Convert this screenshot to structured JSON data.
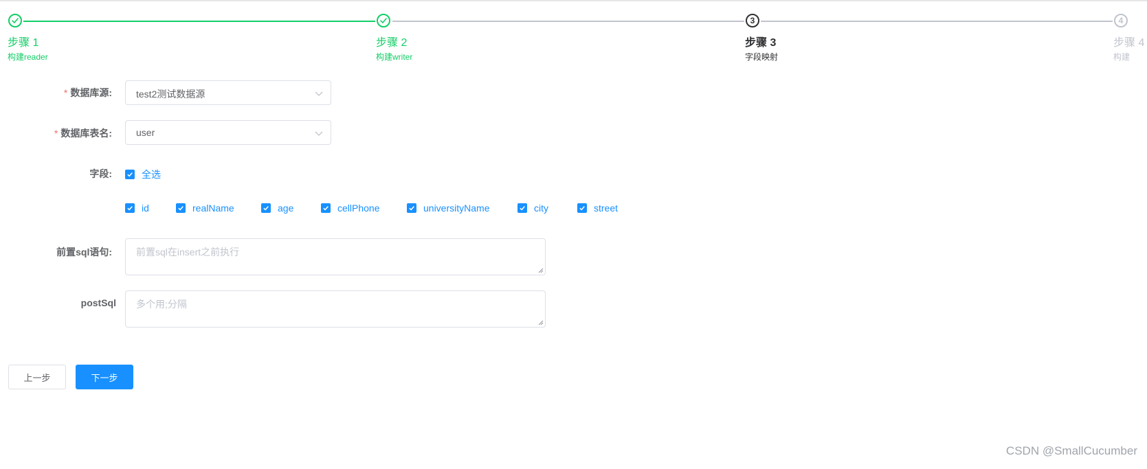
{
  "steps": [
    {
      "title": "步骤 1",
      "desc": "构建reader",
      "status": "done"
    },
    {
      "title": "步骤 2",
      "desc": "构建writer",
      "status": "done"
    },
    {
      "title": "步骤 3",
      "desc": "字段映射",
      "status": "current",
      "number": "3"
    },
    {
      "title": "步骤 4",
      "desc": "构建",
      "status": "wait",
      "number": "4"
    }
  ],
  "form": {
    "datasource": {
      "label": "数据库源:",
      "value": "test2测试数据源"
    },
    "table": {
      "label": "数据库表名:",
      "value": "user"
    },
    "fields": {
      "label": "字段:",
      "select_all": "全选",
      "items": [
        "id",
        "realName",
        "age",
        "cellPhone",
        "universityName",
        "city",
        "street"
      ]
    },
    "presql": {
      "label": "前置sql语句:",
      "placeholder": "前置sql在insert之前执行"
    },
    "postsql": {
      "label": "postSql",
      "placeholder": "多个用;分隔"
    }
  },
  "buttons": {
    "prev": "上一步",
    "next": "下一步"
  },
  "watermark": "CSDN @SmallCucumber",
  "colors": {
    "success": "#13ce66",
    "primary": "#1890ff",
    "required": "#f56c6c",
    "wait": "#c0c4cc"
  }
}
